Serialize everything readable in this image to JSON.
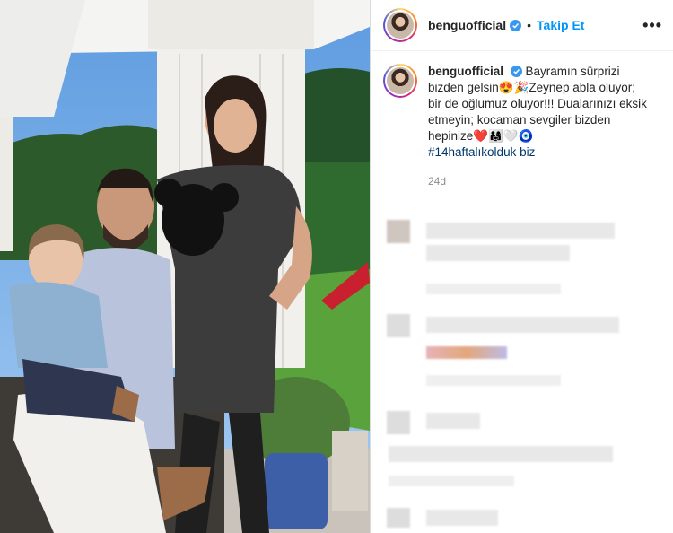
{
  "post": {
    "username": "benguofficial",
    "follow_label": "Takip Et",
    "separator": "•",
    "more_icon": "more-horizontal-icon",
    "caption": {
      "username": "benguofficial",
      "line1": "Bayramın sürprizi bizden gelsin😍🎉Zeynep abla oluyor; bir de oğlumuz oluyor!!! Dualarınızı eksik etmeyin; kocaman sevgiler bizden hepinize❤️👨‍👩‍👧🤍🧿",
      "hashtag": "#14haftalıkolduk biz",
      "time": "24d"
    },
    "colors": {
      "link": "#0095f6",
      "hashtag": "#00376b",
      "muted": "#8e8e8e"
    }
  }
}
